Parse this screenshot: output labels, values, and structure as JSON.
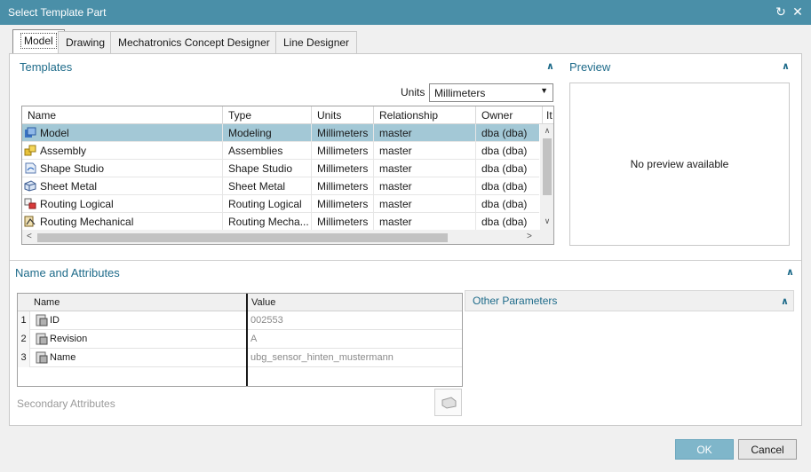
{
  "window": {
    "title": "Select Template Part"
  },
  "tabs": [
    {
      "label": "Model",
      "active": true
    },
    {
      "label": "Drawing"
    },
    {
      "label": "Mechatronics Concept Designer"
    },
    {
      "label": "Line Designer"
    }
  ],
  "templates": {
    "title": "Templates",
    "units_label": "Units",
    "units_value": "Millimeters",
    "columns": [
      "Name",
      "Type",
      "Units",
      "Relationship",
      "Owner",
      "It"
    ],
    "rows": [
      {
        "name": "Model",
        "type": "Modeling",
        "units": "Millimeters",
        "relationship": "master",
        "owner": "dba (dba)",
        "icon": "model-icon",
        "selected": true
      },
      {
        "name": "Assembly",
        "type": "Assemblies",
        "units": "Millimeters",
        "relationship": "master",
        "owner": "dba (dba)",
        "icon": "assembly-icon"
      },
      {
        "name": "Shape Studio",
        "type": "Shape Studio",
        "units": "Millimeters",
        "relationship": "master",
        "owner": "dba (dba)",
        "icon": "shape-studio-icon"
      },
      {
        "name": "Sheet Metal",
        "type": "Sheet Metal",
        "units": "Millimeters",
        "relationship": "master",
        "owner": "dba (dba)",
        "icon": "sheet-metal-icon"
      },
      {
        "name": "Routing Logical",
        "type": "Routing Logical",
        "units": "Millimeters",
        "relationship": "master",
        "owner": "dba (dba)",
        "icon": "routing-logical-icon"
      },
      {
        "name": "Routing Mechanical",
        "type": "Routing Mecha...",
        "units": "Millimeters",
        "relationship": "master",
        "owner": "dba (dba)",
        "icon": "routing-mechanical-icon"
      }
    ]
  },
  "preview": {
    "title": "Preview",
    "text": "No preview available"
  },
  "attributes": {
    "title": "Name and Attributes",
    "columns": [
      "Name",
      "Value"
    ],
    "rows": [
      {
        "num": "1",
        "name": "ID",
        "value": "002553"
      },
      {
        "num": "2",
        "name": "Revision",
        "value": "A"
      },
      {
        "num": "3",
        "name": "Name",
        "value": "ubg_sensor_hinten_mustermann"
      }
    ],
    "secondary_label": "Secondary Attributes"
  },
  "other_parameters": {
    "title": "Other Parameters"
  },
  "buttons": {
    "ok": "OK",
    "cancel": "Cancel"
  },
  "colors": {
    "accent": "#1e6b8a",
    "titlebar": "#4a8fa8",
    "selection": "#a3c8d6",
    "ok_button": "#7fb6ca"
  }
}
